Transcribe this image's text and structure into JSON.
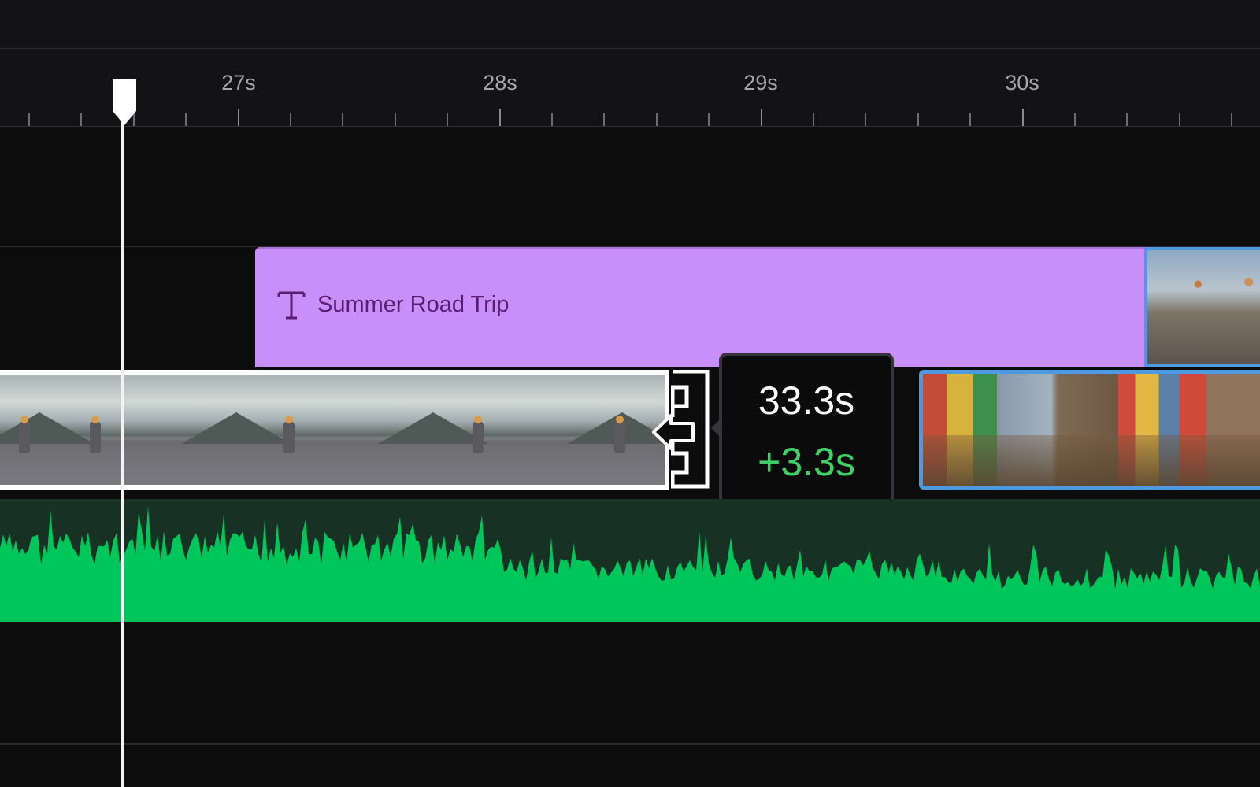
{
  "ruler": {
    "labels": [
      "27s",
      "28s",
      "29s",
      "30s"
    ]
  },
  "title_clip": {
    "label": "Summer Road Trip",
    "color": "#c88ff8"
  },
  "trim_tooltip": {
    "duration": "33.3s",
    "delta": "+3.3s",
    "delta_color": "#3fcf63"
  },
  "colors": {
    "selection_outline": "#ffffff",
    "clip_outline": "#4d9ae0",
    "audio_waveform": "#00c75b",
    "audio_background": "#173124",
    "playhead": "#f2f2f2"
  }
}
